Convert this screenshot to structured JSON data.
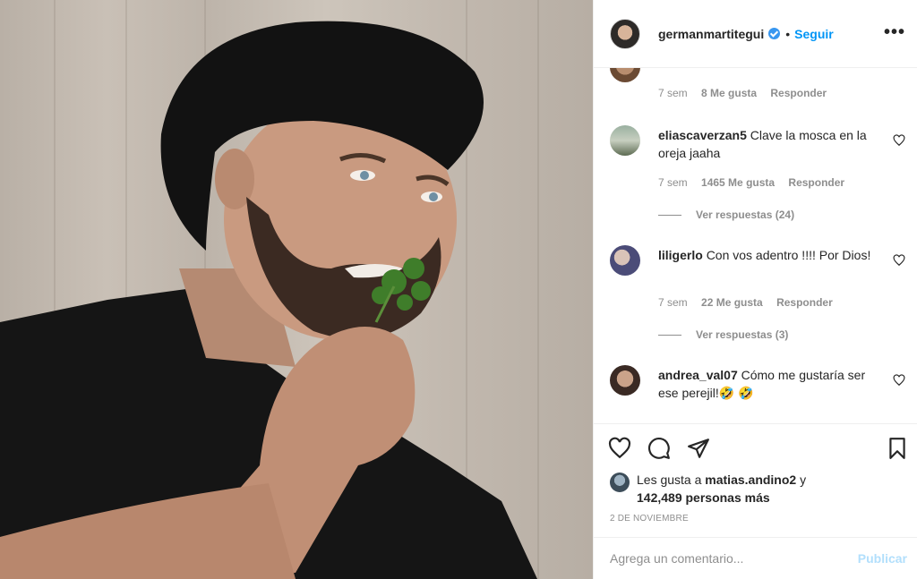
{
  "post": {
    "photo_alt": ""
  },
  "header": {
    "username": "germanmartitegui",
    "separator": "•",
    "follow_label": "Seguir",
    "more_label": "•••"
  },
  "comments": [
    {
      "time": "7 sem",
      "likes": "8 Me gusta",
      "reply_label": "Responder"
    },
    {
      "username": "eliascaverzan5",
      "text": "Clave la mosca en la oreja jaaha",
      "time": "7 sem",
      "likes": "1465 Me gusta",
      "reply_label": "Responder",
      "view_replies": "Ver respuestas (24)"
    },
    {
      "username": "liligerlo",
      "text": "Con vos adentro !!!! Por Dios!",
      "time": "7 sem",
      "likes": "22 Me gusta",
      "reply_label": "Responder",
      "view_replies": "Ver respuestas (3)"
    },
    {
      "username": "andrea_val07",
      "text": "Cómo me gustaría ser ese perejil!🤣 🤣"
    }
  ],
  "likes_info": {
    "prefix": "Les gusta a",
    "user": "matias.andino2",
    "conjunction": "y",
    "count": "142,489 personas más"
  },
  "date": "2 DE NOVIEMBRE",
  "add_comment": {
    "placeholder": "Agrega un comentario...",
    "publish_label": "Publicar"
  },
  "colors": {
    "accent": "#0095f6",
    "publish_disabled": "#b2dffc",
    "muted": "#8e8e8e",
    "text": "#262626"
  }
}
